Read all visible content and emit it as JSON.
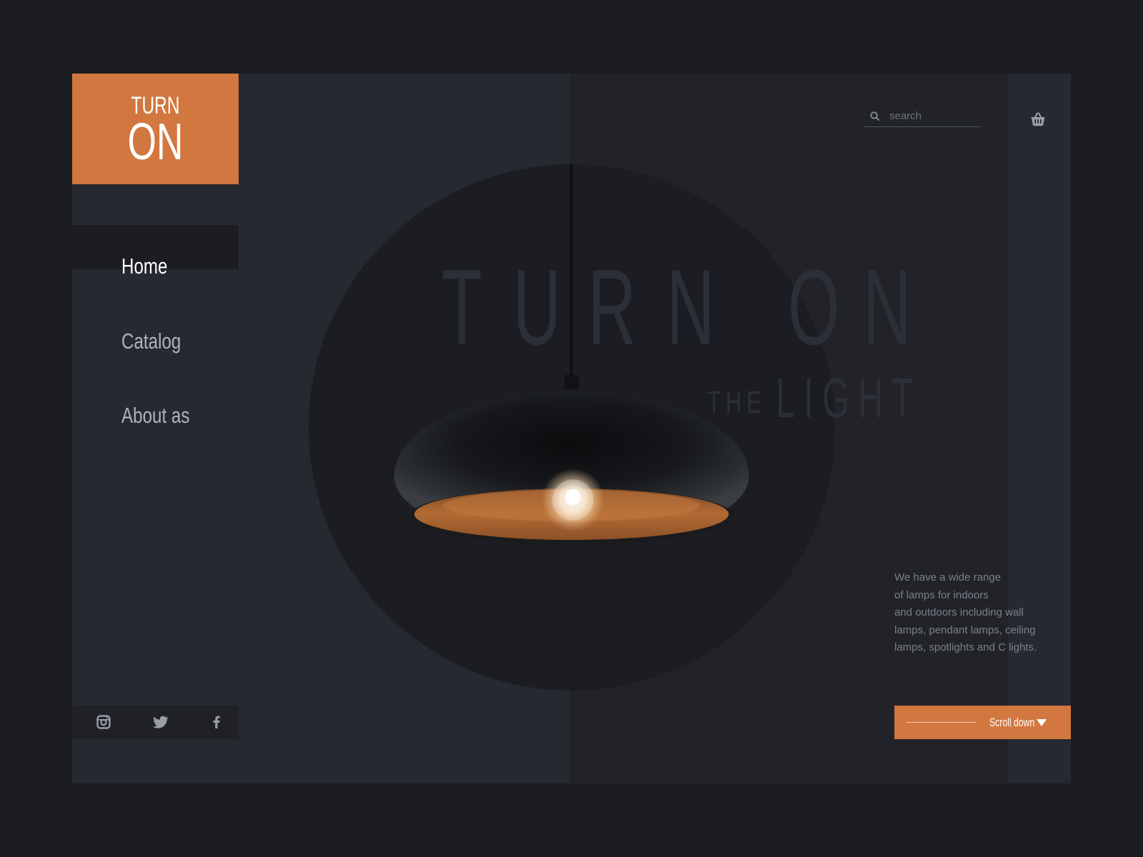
{
  "brand": {
    "line1": "TURN",
    "line2": "ON"
  },
  "nav": {
    "items": [
      {
        "label": "Home",
        "active": true
      },
      {
        "label": "Catalog",
        "active": false
      },
      {
        "label": "About as",
        "active": false
      }
    ]
  },
  "search": {
    "placeholder": "search",
    "value": ""
  },
  "hero": {
    "title_letters": [
      "T",
      "U",
      "R",
      "N",
      "O",
      "N"
    ],
    "subtitle_small": "THE",
    "subtitle_large": "LIGHT"
  },
  "description": {
    "lines": [
      "We have a wide range",
      "of lamps for indoors",
      "and outdoors including wall",
      "lamps, pendant lamps, ceiling",
      "lamps, spotlights and C lights."
    ]
  },
  "scroll_button": {
    "label": "Scroll down"
  },
  "social": [
    "instagram-icon",
    "twitter-icon",
    "facebook-icon"
  ],
  "colors": {
    "accent": "#d2773f",
    "background": "#1a1c21",
    "panel": "#262930",
    "circle": "#1b1d23"
  }
}
